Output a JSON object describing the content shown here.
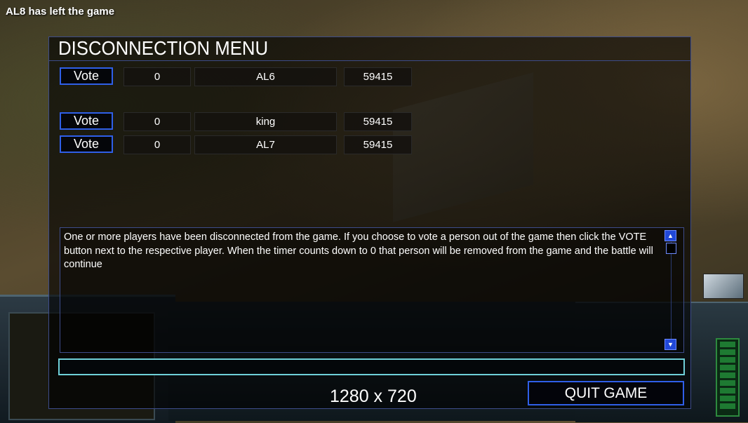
{
  "notification": "AL8 has left the game",
  "menu": {
    "title": "DISCONNECTION MENU",
    "players": [
      {
        "vote_label": "Vote",
        "timer": "0",
        "name": "AL6",
        "ping": "59415"
      },
      {
        "vote_label": "Vote",
        "timer": "0",
        "name": "king",
        "ping": "59415"
      },
      {
        "vote_label": "Vote",
        "timer": "0",
        "name": "AL7",
        "ping": "59415"
      }
    ],
    "message": "One or more players have been disconnected from the game. If you choose to vote a person out of the game then click the VOTE button next to the respective player. When the timer counts down to 0 that person will be removed from the game and the battle will continue",
    "chat_value": "",
    "quit_label": "QUIT GAME",
    "resolution": "1280 x 720"
  },
  "colors": {
    "button_border": "#2f5fe8",
    "chat_border": "#6fd0d8",
    "panel_border": "#3d4c8a"
  }
}
